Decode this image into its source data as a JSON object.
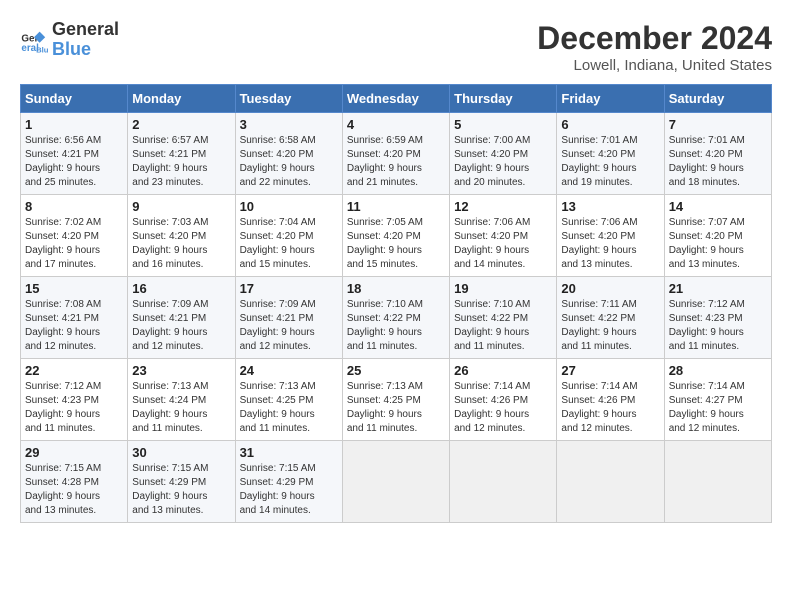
{
  "logo": {
    "line1": "General",
    "line2": "Blue"
  },
  "title": "December 2024",
  "subtitle": "Lowell, Indiana, United States",
  "days_of_week": [
    "Sunday",
    "Monday",
    "Tuesday",
    "Wednesday",
    "Thursday",
    "Friday",
    "Saturday"
  ],
  "weeks": [
    [
      {
        "day": "1",
        "info": "Sunrise: 6:56 AM\nSunset: 4:21 PM\nDaylight: 9 hours\nand 25 minutes."
      },
      {
        "day": "2",
        "info": "Sunrise: 6:57 AM\nSunset: 4:21 PM\nDaylight: 9 hours\nand 23 minutes."
      },
      {
        "day": "3",
        "info": "Sunrise: 6:58 AM\nSunset: 4:20 PM\nDaylight: 9 hours\nand 22 minutes."
      },
      {
        "day": "4",
        "info": "Sunrise: 6:59 AM\nSunset: 4:20 PM\nDaylight: 9 hours\nand 21 minutes."
      },
      {
        "day": "5",
        "info": "Sunrise: 7:00 AM\nSunset: 4:20 PM\nDaylight: 9 hours\nand 20 minutes."
      },
      {
        "day": "6",
        "info": "Sunrise: 7:01 AM\nSunset: 4:20 PM\nDaylight: 9 hours\nand 19 minutes."
      },
      {
        "day": "7",
        "info": "Sunrise: 7:01 AM\nSunset: 4:20 PM\nDaylight: 9 hours\nand 18 minutes."
      }
    ],
    [
      {
        "day": "8",
        "info": "Sunrise: 7:02 AM\nSunset: 4:20 PM\nDaylight: 9 hours\nand 17 minutes."
      },
      {
        "day": "9",
        "info": "Sunrise: 7:03 AM\nSunset: 4:20 PM\nDaylight: 9 hours\nand 16 minutes."
      },
      {
        "day": "10",
        "info": "Sunrise: 7:04 AM\nSunset: 4:20 PM\nDaylight: 9 hours\nand 15 minutes."
      },
      {
        "day": "11",
        "info": "Sunrise: 7:05 AM\nSunset: 4:20 PM\nDaylight: 9 hours\nand 15 minutes."
      },
      {
        "day": "12",
        "info": "Sunrise: 7:06 AM\nSunset: 4:20 PM\nDaylight: 9 hours\nand 14 minutes."
      },
      {
        "day": "13",
        "info": "Sunrise: 7:06 AM\nSunset: 4:20 PM\nDaylight: 9 hours\nand 13 minutes."
      },
      {
        "day": "14",
        "info": "Sunrise: 7:07 AM\nSunset: 4:20 PM\nDaylight: 9 hours\nand 13 minutes."
      }
    ],
    [
      {
        "day": "15",
        "info": "Sunrise: 7:08 AM\nSunset: 4:21 PM\nDaylight: 9 hours\nand 12 minutes."
      },
      {
        "day": "16",
        "info": "Sunrise: 7:09 AM\nSunset: 4:21 PM\nDaylight: 9 hours\nand 12 minutes."
      },
      {
        "day": "17",
        "info": "Sunrise: 7:09 AM\nSunset: 4:21 PM\nDaylight: 9 hours\nand 12 minutes."
      },
      {
        "day": "18",
        "info": "Sunrise: 7:10 AM\nSunset: 4:22 PM\nDaylight: 9 hours\nand 11 minutes."
      },
      {
        "day": "19",
        "info": "Sunrise: 7:10 AM\nSunset: 4:22 PM\nDaylight: 9 hours\nand 11 minutes."
      },
      {
        "day": "20",
        "info": "Sunrise: 7:11 AM\nSunset: 4:22 PM\nDaylight: 9 hours\nand 11 minutes."
      },
      {
        "day": "21",
        "info": "Sunrise: 7:12 AM\nSunset: 4:23 PM\nDaylight: 9 hours\nand 11 minutes."
      }
    ],
    [
      {
        "day": "22",
        "info": "Sunrise: 7:12 AM\nSunset: 4:23 PM\nDaylight: 9 hours\nand 11 minutes."
      },
      {
        "day": "23",
        "info": "Sunrise: 7:13 AM\nSunset: 4:24 PM\nDaylight: 9 hours\nand 11 minutes."
      },
      {
        "day": "24",
        "info": "Sunrise: 7:13 AM\nSunset: 4:25 PM\nDaylight: 9 hours\nand 11 minutes."
      },
      {
        "day": "25",
        "info": "Sunrise: 7:13 AM\nSunset: 4:25 PM\nDaylight: 9 hours\nand 11 minutes."
      },
      {
        "day": "26",
        "info": "Sunrise: 7:14 AM\nSunset: 4:26 PM\nDaylight: 9 hours\nand 12 minutes."
      },
      {
        "day": "27",
        "info": "Sunrise: 7:14 AM\nSunset: 4:26 PM\nDaylight: 9 hours\nand 12 minutes."
      },
      {
        "day": "28",
        "info": "Sunrise: 7:14 AM\nSunset: 4:27 PM\nDaylight: 9 hours\nand 12 minutes."
      }
    ],
    [
      {
        "day": "29",
        "info": "Sunrise: 7:15 AM\nSunset: 4:28 PM\nDaylight: 9 hours\nand 13 minutes."
      },
      {
        "day": "30",
        "info": "Sunrise: 7:15 AM\nSunset: 4:29 PM\nDaylight: 9 hours\nand 13 minutes."
      },
      {
        "day": "31",
        "info": "Sunrise: 7:15 AM\nSunset: 4:29 PM\nDaylight: 9 hours\nand 14 minutes."
      },
      null,
      null,
      null,
      null
    ]
  ]
}
